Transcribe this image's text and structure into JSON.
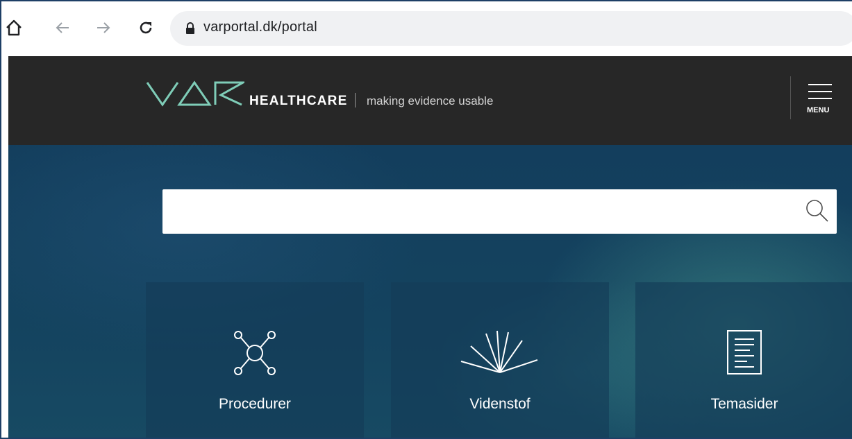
{
  "browser": {
    "url": "varportal.dk/portal",
    "icons": [
      "home-icon",
      "back-icon",
      "forward-icon",
      "reload-icon",
      "lock-icon"
    ]
  },
  "header": {
    "logo_text": "VAR",
    "brand": "HEALTHCARE",
    "tagline": "making evidence usable",
    "menu_label": "MENU"
  },
  "search": {
    "placeholder": "",
    "value": ""
  },
  "tiles": [
    {
      "label": "Procedurer",
      "icon": "network-icon"
    },
    {
      "label": "Videnstof",
      "icon": "fan-rays-icon"
    },
    {
      "label": "Temasider",
      "icon": "document-icon"
    }
  ],
  "colors": {
    "header_bg": "#272727",
    "logo_accent": "#7fcdb8",
    "hero_bg": "#133e5d"
  }
}
